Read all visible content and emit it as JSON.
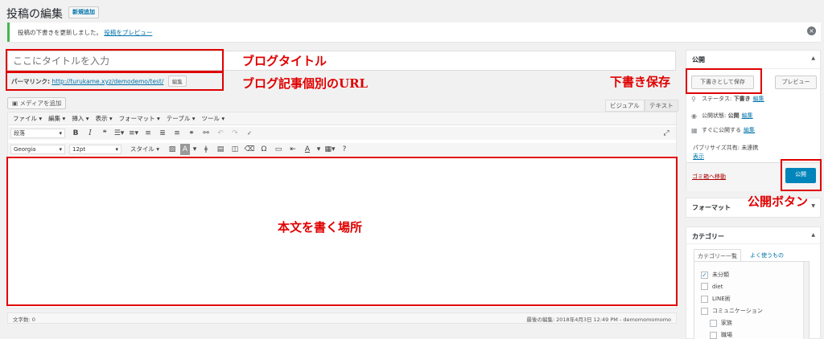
{
  "header": {
    "title": "投稿の編集",
    "add_new": "新規追加"
  },
  "notice": {
    "text": "投稿の下書きを更新しました。",
    "link": "投稿をプレビュー"
  },
  "post": {
    "title_placeholder": "ここにタイトルを入力",
    "permalink_label": "パーマリンク:",
    "permalink_url": "http://turukame.xyz/demodemo/test/",
    "permalink_edit": "編集"
  },
  "editor": {
    "add_media": "メディアを追加",
    "tabs": {
      "visual": "ビジュアル",
      "text": "テキスト"
    },
    "menus": [
      "ファイル ▾",
      "編集 ▾",
      "挿入 ▾",
      "表示 ▾",
      "フォーマット ▾",
      "テーブル ▾",
      "ツール ▾"
    ],
    "format_select": "段落",
    "font_select": "Georgia",
    "size_select": "12pt",
    "style_select": "スタイル ▾",
    "word_count": "文字数: 0",
    "last_edited": "最後の編集: 2018年4月3日 12:49 PM - demomomomomo"
  },
  "publish": {
    "title": "公開",
    "save_draft": "下書きとして保存",
    "preview": "プレビュー",
    "status_label": "ステータス:",
    "status_value": "下書き",
    "visibility_label": "公開状態:",
    "visibility_value": "公開",
    "schedule_label": "すぐに公開する",
    "edit_link": "編集",
    "public_share": "パブリサイズ共有: 未連携",
    "public_share_link": "表示",
    "trash": "ゴミ箱へ移動",
    "publish_btn": "公開"
  },
  "format_box": {
    "title": "フォーマット"
  },
  "categories": {
    "title": "カテゴリー",
    "tab_all": "カテゴリー一覧",
    "tab_popular": "よく使うもの",
    "items": [
      {
        "label": "未分類",
        "checked": true
      },
      {
        "label": "diet",
        "checked": false
      },
      {
        "label": "LINE術",
        "checked": false
      },
      {
        "label": "コミュニケーション",
        "checked": false
      },
      {
        "label": "家族",
        "checked": false
      },
      {
        "label": "職場",
        "checked": false
      }
    ]
  },
  "annotations": {
    "blog_title": "ブログタイトル",
    "blog_url": "ブログ記事個別のURL",
    "body_area": "本文を書く場所",
    "draft_save": "下書き保存",
    "publish_button": "公開ボタン"
  },
  "colors": {
    "accent": "#0085ba",
    "annotation": "#e00000",
    "link": "#0073aa"
  }
}
